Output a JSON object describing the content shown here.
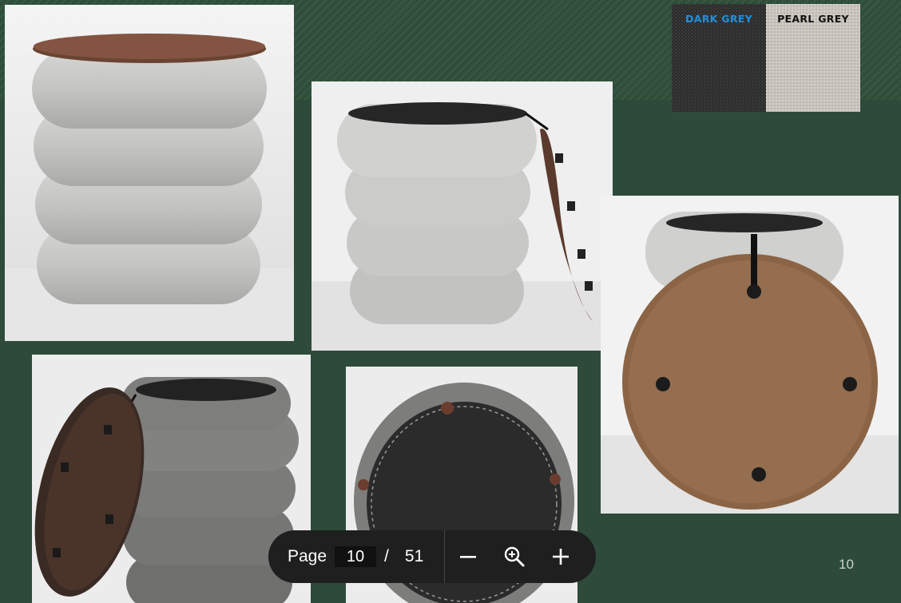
{
  "swatches": [
    {
      "label": "DARK GREY",
      "label_color": "#1e90e0",
      "fabric_color": "#2f2f2f"
    },
    {
      "label": "PEARL GREY",
      "label_color": "#111111",
      "fabric_color": "#cbc7c0"
    }
  ],
  "slide_number": "10",
  "viewer": {
    "page_label": "Page",
    "current_page": "10",
    "separator": "/",
    "total_pages": "51"
  },
  "icons": {
    "zoom_out": "minus-icon",
    "fit": "zoom-icon",
    "zoom_in": "plus-icon"
  },
  "colors": {
    "background": "#2e4a3b",
    "toolbar": "#1f1f1f",
    "light_fabric": "#c8c8c6",
    "dark_fabric": "#7a7a79",
    "wood": "#7b4f35"
  }
}
